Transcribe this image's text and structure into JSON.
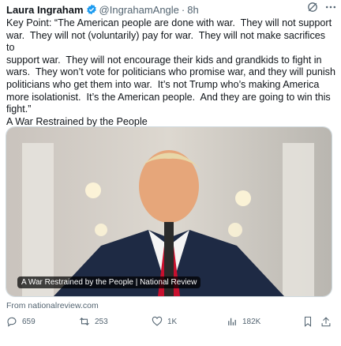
{
  "author": {
    "name": "Laura Ingraham",
    "handle": "@IngrahamAngle",
    "separator": "·",
    "time": "8h"
  },
  "tweet_text": "Key Point: “The American people are done with war.  They will not support\nwar.  They will not (voluntarily) pay for war.  They will not make sacrifices to\nsupport war.  They will not encourage their kids and grandkids to fight in\nwars.  They won’t vote for politicians who promise war, and they will punish\npoliticians who get them into war.  It’s not Trump who’s making America\nmore isolationist.  It’s the American people.  And they are going to win this\nfight.”\nA War Restrained by the People",
  "card": {
    "caption": "A War Restrained by the People | National Review",
    "source": "From nationalreview.com"
  },
  "actions": {
    "replies": "659",
    "reposts": "253",
    "likes": "1K",
    "views": "182K"
  },
  "colors": {
    "verified": "#1d9bf0",
    "muted": "#536471",
    "text": "#0f1419"
  },
  "icons": [
    "verified-badge-icon",
    "grok-icon",
    "more-icon",
    "reply-icon",
    "repost-icon",
    "like-icon",
    "views-icon",
    "bookmark-icon",
    "share-icon"
  ]
}
